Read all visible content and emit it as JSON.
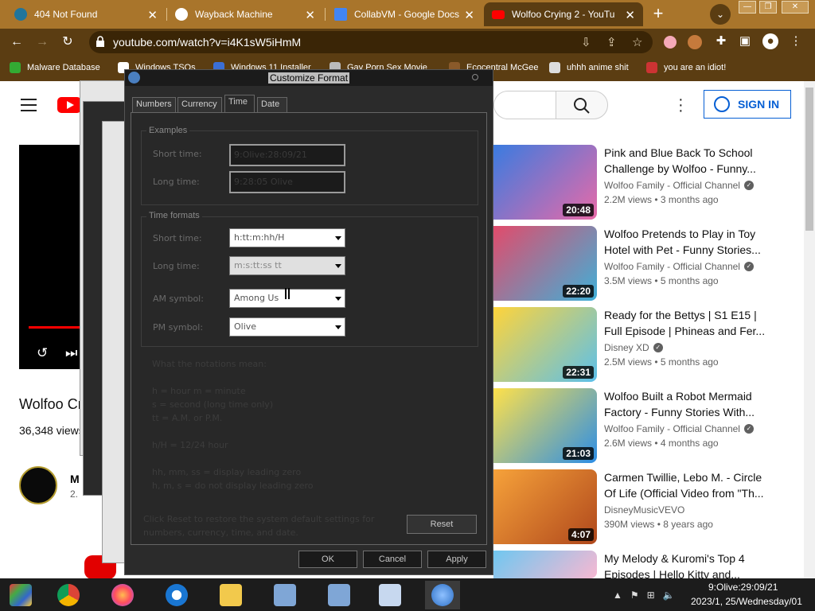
{
  "browser": {
    "tabs": [
      {
        "title": "404 Not Found",
        "icon": "wordpress-icon"
      },
      {
        "title": "Wayback Machine",
        "icon": "globe-icon"
      },
      {
        "title": "CollabVM - Google Docs",
        "icon": "docs-icon"
      },
      {
        "title": "Wolfoo Crying 2 - YouTu",
        "icon": "youtube-icon",
        "active": true
      }
    ],
    "tab_close_glyph": "✕",
    "new_tab_glyph": "+",
    "tab_search_glyph": "⌄",
    "window_controls": [
      "—",
      "❐",
      "✕"
    ],
    "url": "youtube.com/watch?v=i4K1sW5iHmM",
    "bookmarks": [
      "Malware Database",
      "Windows TSOs",
      "Windows 11 Installer",
      "Gay Porn Sex Movie",
      "Ecocentral McGee",
      "uhhh anime shit",
      "you are an idiot!"
    ]
  },
  "youtube": {
    "signin_label": "SIGN IN",
    "video_title": "Wolfoo Cr",
    "video_views": "36,348 views",
    "channel_initial": "M",
    "channel_sub": "2.",
    "related": [
      {
        "title": "Pink and Blue Back To School Challenge by Wolfoo - Funny...",
        "channel": "Wolfoo Family - Official Channel",
        "verified": true,
        "meta": "2.2M views • 3 months ago",
        "duration": "20:48"
      },
      {
        "title": "Wolfoo Pretends to Play in Toy Hotel with Pet - Funny Stories...",
        "channel": "Wolfoo Family - Official Channel",
        "verified": true,
        "meta": "3.5M views • 5 months ago",
        "duration": "22:20"
      },
      {
        "title": "Ready for the Bettys | S1 E15 | Full Episode | Phineas and Fer...",
        "channel": "Disney XD",
        "verified": true,
        "meta": "2.5M views • 5 months ago",
        "duration": "22:31"
      },
      {
        "title": "Wolfoo Built a Robot Mermaid Factory - Funny Stories With...",
        "channel": "Wolfoo Family - Official Channel",
        "verified": true,
        "meta": "2.6M views • 4 months ago",
        "duration": "21:03"
      },
      {
        "title": "Carmen Twillie, Lebo M. - Circle Of Life (Official Video from \"Th...",
        "channel": "DisneyMusicVEVO",
        "verified": false,
        "meta": "390M views • 8 years ago",
        "duration": "4:07"
      },
      {
        "title": "My Melody & Kuromi's Top 4 Episodes | Hello Kitty and...",
        "channel": "",
        "verified": false,
        "meta": "",
        "duration": ""
      }
    ]
  },
  "dialog": {
    "title": "Customize Format",
    "tabs": [
      "Numbers",
      "Currency",
      "Time",
      "Date"
    ],
    "selected_tab": "Time",
    "examples_group": "Examples",
    "short_time_label": "Short time:",
    "short_time_example": "9:Olive:28:09/21",
    "long_time_label": "Long time:",
    "long_time_example": "9:28:05 Olive",
    "formats_group": "Time formats",
    "short_time_format": "h:tt:m:hh/H",
    "long_time_format": "m:s:tt:ss tt",
    "am_label": "AM symbol:",
    "am_value": "Among Us",
    "pm_label": "PM symbol:",
    "pm_value": "Olive",
    "notes_heading": "What the notations mean:",
    "notes": [
      "h = hour   m = minute",
      "s = second (long time only)",
      "tt = A.M. or P.M.",
      "h/H = 12/24 hour",
      "hh, mm, ss = display leading zero",
      "h, m, s = do not display leading zero"
    ],
    "reset_text_1": "Click Reset to restore the system default settings for",
    "reset_text_2": "numbers, currency, time, and date.",
    "reset_label": "Reset",
    "ok_label": "OK",
    "cancel_label": "Cancel",
    "apply_label": "Apply"
  },
  "taskbar": {
    "clock_time": "9:Olive:29:09/21",
    "clock_date": "2023/1, 25/Wednesday/01",
    "tray_glyphs": [
      "▲",
      "⚑",
      "⊞",
      "🔈"
    ]
  },
  "colors": {
    "tabstrip": "#a9752b",
    "toolbar": "#5b3d12",
    "youtube_red": "#ff0000",
    "signin_blue": "#065fd4",
    "dialog_bg": "#2b2b2b",
    "taskbar": "#1c1c1c"
  }
}
